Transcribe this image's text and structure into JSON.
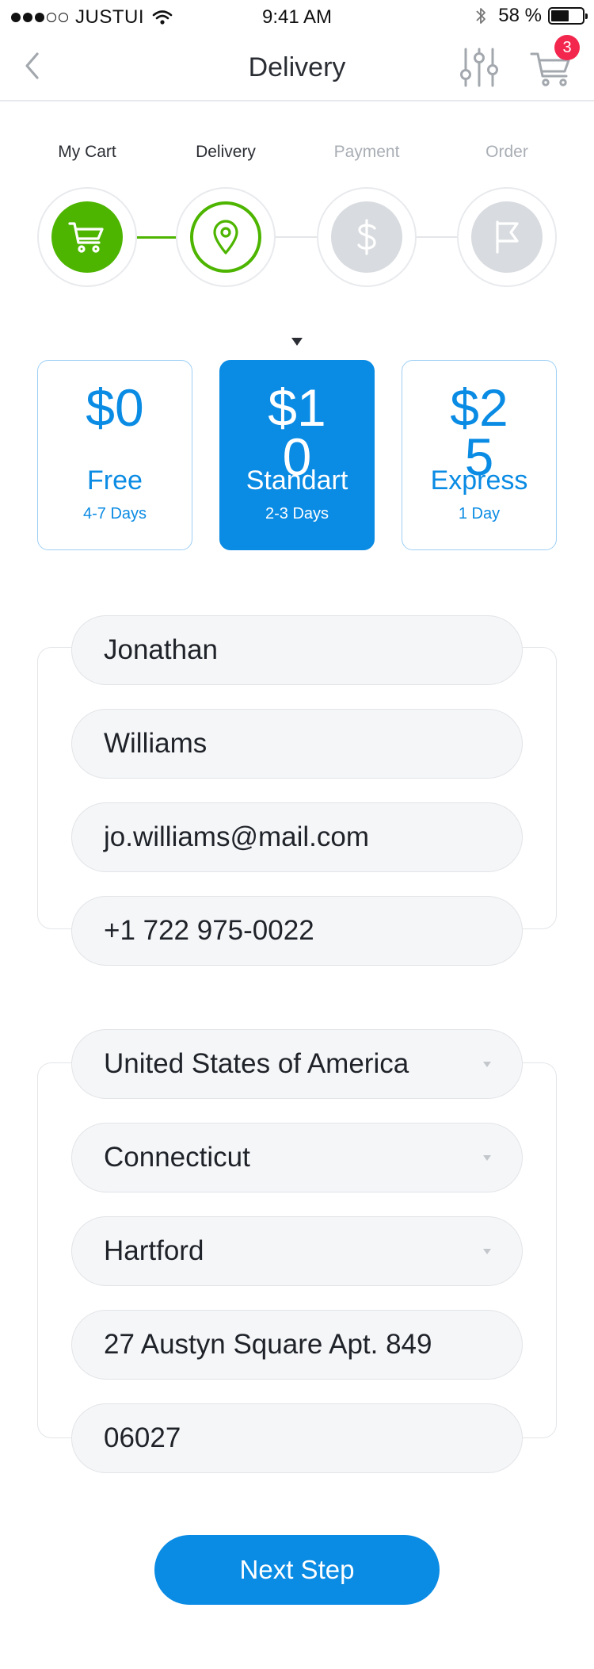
{
  "status_bar": {
    "carrier": "JUSTUI",
    "time": "9:41 AM",
    "battery_percent": "58 %",
    "battery_level": 0.58
  },
  "nav": {
    "title": "Delivery",
    "cart_count": "3"
  },
  "steps": [
    {
      "label": "My Cart",
      "icon": "cart-icon",
      "state": "done"
    },
    {
      "label": "Delivery",
      "icon": "location-pin-icon",
      "state": "current"
    },
    {
      "label": "Payment",
      "icon": "dollar-icon",
      "state": "todo"
    },
    {
      "label": "Order",
      "icon": "flag-icon",
      "state": "todo"
    }
  ],
  "delivery_options": [
    {
      "price": "$0",
      "name": "Free",
      "days": "4-7 Days",
      "selected": false
    },
    {
      "price": "$10",
      "name": "Standart",
      "days": "2-3 Days",
      "selected": true
    },
    {
      "price": "$25",
      "name": "Express",
      "days": "1 Day",
      "selected": false
    }
  ],
  "contact": {
    "first_name": "Jonathan",
    "last_name": "Williams",
    "email": "jo.williams@mail.com",
    "phone": "+1 722 975-0022"
  },
  "address": {
    "country": "United States of America",
    "state": "Connecticut",
    "city": "Hartford",
    "street": "27 Austyn Square Apt. 849",
    "zip": "06027"
  },
  "actions": {
    "next_label": "Next Step"
  },
  "colors": {
    "accent": "#0a8be4",
    "success": "#4db500",
    "badge": "#f3264d",
    "inactive": "#d8dbdf"
  }
}
